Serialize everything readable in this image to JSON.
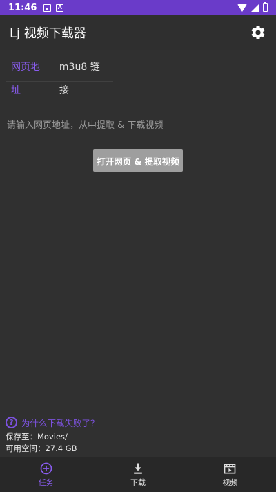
{
  "status_bar": {
    "time": "11:46",
    "notif_icon_a": "A"
  },
  "app_bar": {
    "title": "Lj 视频下载器"
  },
  "tabs": [
    {
      "label": "网页地址",
      "active": true
    },
    {
      "label": "m3u8 链接",
      "active": false
    }
  ],
  "url_input": {
    "value": "",
    "placeholder": "请输入网页地址，从中提取 & 下载视频"
  },
  "open_button": {
    "label": "打开网页 & 提取视频"
  },
  "help": {
    "icon": "?",
    "text": "为什么下载失败了？"
  },
  "storage": {
    "save_to": "保存至：Movies/",
    "free_space": "可用空间：27.4 GB"
  },
  "bottom_nav": [
    {
      "label": "任务",
      "icon": "add-circle-icon",
      "active": true
    },
    {
      "label": "下载",
      "icon": "download-icon",
      "active": false
    },
    {
      "label": "视频",
      "icon": "video-clapper-icon",
      "active": false
    }
  ],
  "colors": {
    "accent": "#8a5cf0",
    "status_bar": "#6a3bc9",
    "background": "#303030",
    "button": "#9e9e9e"
  }
}
